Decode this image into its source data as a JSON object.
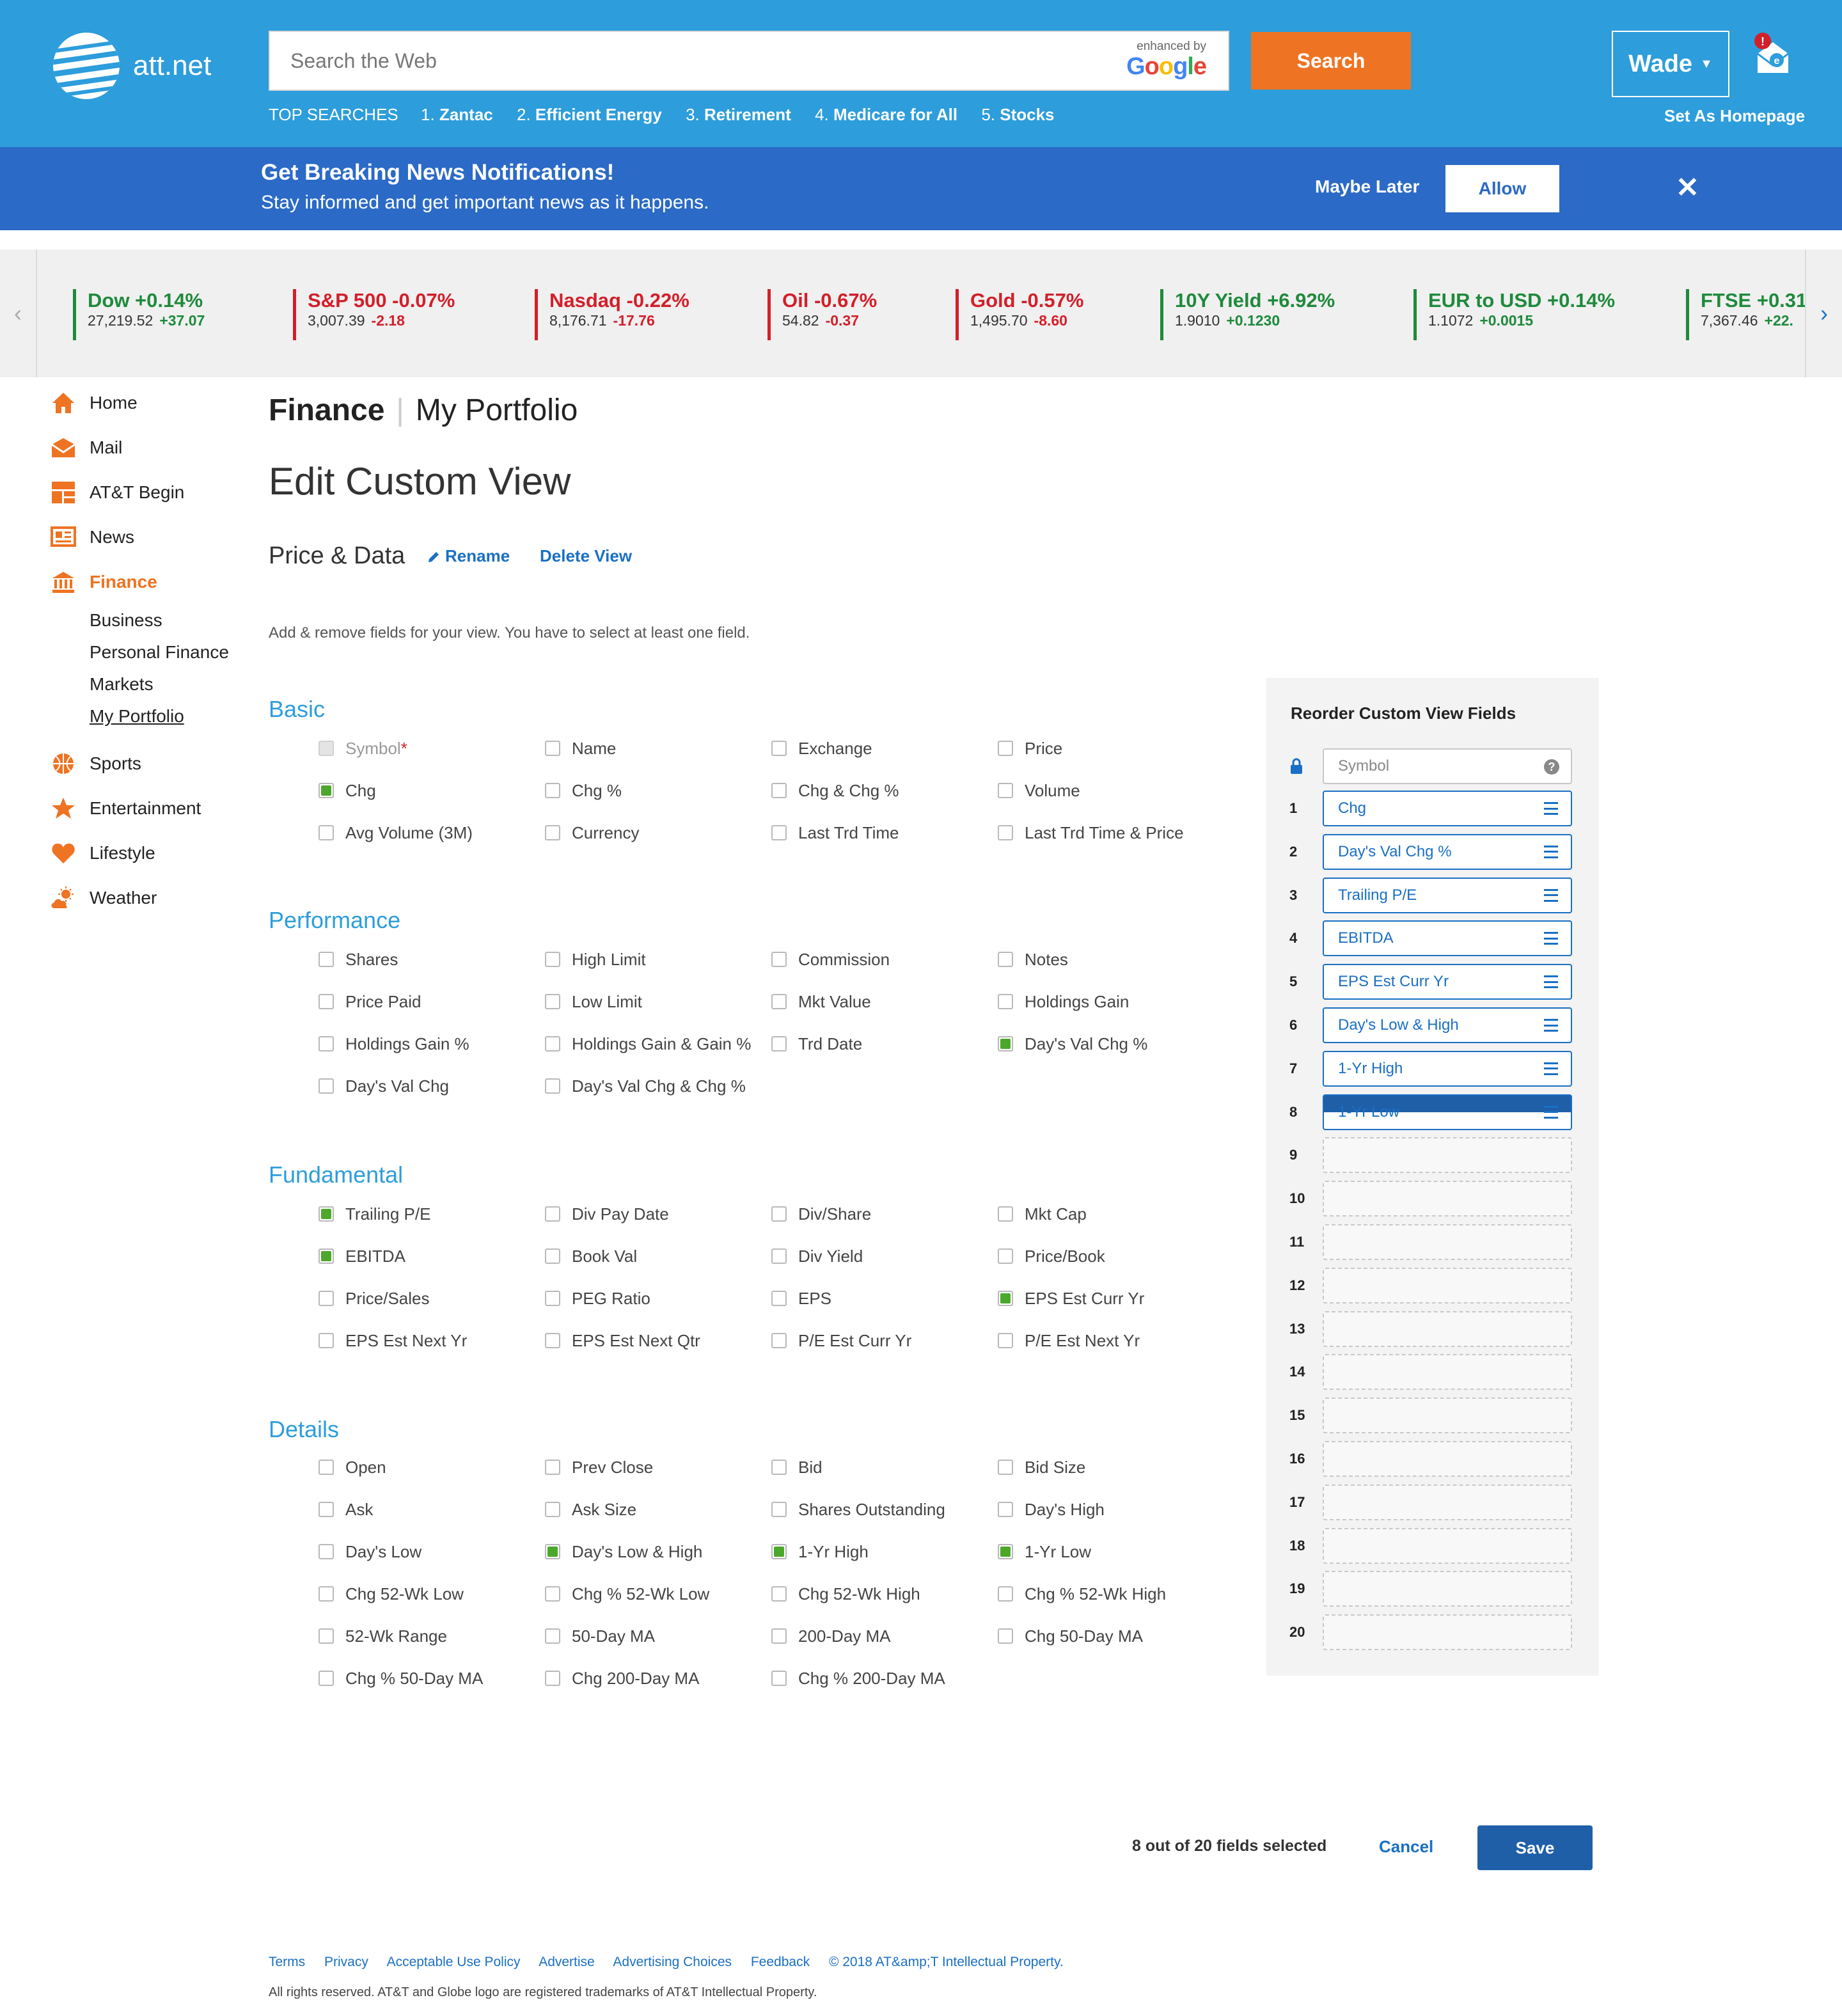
{
  "header": {
    "logo_text": "att.net",
    "search_placeholder": "Search the Web",
    "enhanced_by": "enhanced by",
    "google": "Google",
    "search_button": "Search",
    "top_searches_label": "TOP SEARCHES",
    "top_searches": [
      {
        "num": "1.",
        "term": "Zantac"
      },
      {
        "num": "2.",
        "term": "Efficient Energy"
      },
      {
        "num": "3.",
        "term": "Retirement"
      },
      {
        "num": "4.",
        "term": "Medicare for All"
      },
      {
        "num": "5.",
        "term": "Stocks"
      }
    ],
    "user_name": "Wade",
    "mail_badge": "!",
    "set_homepage": "Set As Homepage"
  },
  "notification": {
    "title": "Get Breaking News Notifications!",
    "subtitle": "Stay informed and get important news as it happens.",
    "maybe_later": "Maybe Later",
    "allow": "Allow"
  },
  "ticker": [
    {
      "name": "Dow +0.14%",
      "value": "27,219.52",
      "change": "+37.07",
      "dir": "up"
    },
    {
      "name": "S&P 500 -0.07%",
      "value": "3,007.39",
      "change": "-2.18",
      "dir": "down"
    },
    {
      "name": "Nasdaq -0.22%",
      "value": "8,176.71",
      "change": "-17.76",
      "dir": "down"
    },
    {
      "name": "Oil -0.67%",
      "value": "54.82",
      "change": "-0.37",
      "dir": "down"
    },
    {
      "name": "Gold -0.57%",
      "value": "1,495.70",
      "change": "-8.60",
      "dir": "down"
    },
    {
      "name": "10Y Yield +6.92%",
      "value": "1.9010",
      "change": "+0.1230",
      "dir": "up"
    },
    {
      "name": "EUR to USD +0.14%",
      "value": "1.1072",
      "change": "+0.0015",
      "dir": "up"
    },
    {
      "name": "FTSE +0.31",
      "value": "7,367.46",
      "change": "+22.",
      "dir": "up"
    }
  ],
  "nav": {
    "items": [
      {
        "label": "Home",
        "icon": "home-icon"
      },
      {
        "label": "Mail",
        "icon": "mail-icon"
      },
      {
        "label": "AT&T Begin",
        "icon": "begin-icon"
      },
      {
        "label": "News",
        "icon": "news-icon"
      },
      {
        "label": "Finance",
        "icon": "finance-icon"
      },
      {
        "label": "Sports",
        "icon": "sports-icon"
      },
      {
        "label": "Entertainment",
        "icon": "star-icon"
      },
      {
        "label": "Lifestyle",
        "icon": "heart-icon"
      },
      {
        "label": "Weather",
        "icon": "weather-icon"
      }
    ],
    "finance_sub": [
      "Business",
      "Personal Finance",
      "Markets",
      "My Portfolio"
    ]
  },
  "main": {
    "breadcrumb_section": "Finance",
    "breadcrumb_page": "My Portfolio",
    "title": "Edit Custom View",
    "view_name": "Price & Data",
    "rename": "Rename",
    "delete_view": "Delete View",
    "instructions": "Add & remove fields for your view. You have to select at least one field.",
    "sections": [
      {
        "title": "Basic",
        "fields": [
          {
            "label": "Symbol",
            "checked": true,
            "disabled": true,
            "required": "*"
          },
          {
            "label": "Name",
            "checked": false
          },
          {
            "label": "Exchange",
            "checked": false
          },
          {
            "label": "Price",
            "checked": false
          },
          {
            "label": "Chg",
            "checked": true
          },
          {
            "label": "Chg %",
            "checked": false
          },
          {
            "label": "Chg & Chg %",
            "checked": false
          },
          {
            "label": "Volume",
            "checked": false
          },
          {
            "label": "Avg Volume (3M)",
            "checked": false
          },
          {
            "label": "Currency",
            "checked": false
          },
          {
            "label": "Last Trd Time",
            "checked": false
          },
          {
            "label": "Last Trd Time & Price",
            "checked": false
          }
        ]
      },
      {
        "title": "Performance",
        "fields": [
          {
            "label": "Shares",
            "checked": false
          },
          {
            "label": "High Limit",
            "checked": false
          },
          {
            "label": "Commission",
            "checked": false
          },
          {
            "label": "Notes",
            "checked": false
          },
          {
            "label": "Price Paid",
            "checked": false
          },
          {
            "label": "Low Limit",
            "checked": false
          },
          {
            "label": "Mkt Value",
            "checked": false
          },
          {
            "label": "Holdings Gain",
            "checked": false
          },
          {
            "label": "Holdings Gain %",
            "checked": false
          },
          {
            "label": "Holdings Gain & Gain %",
            "checked": false
          },
          {
            "label": "Trd Date",
            "checked": false
          },
          {
            "label": "Day's Val Chg %",
            "checked": true
          },
          {
            "label": "Day's Val Chg",
            "checked": false
          },
          {
            "label": "Day's Val Chg & Chg %",
            "checked": false
          }
        ]
      },
      {
        "title": "Fundamental",
        "fields": [
          {
            "label": "Trailing P/E",
            "checked": true
          },
          {
            "label": "Div Pay Date",
            "checked": false
          },
          {
            "label": "Div/Share",
            "checked": false
          },
          {
            "label": "Mkt Cap",
            "checked": false
          },
          {
            "label": "EBITDA",
            "checked": true
          },
          {
            "label": "Book Val",
            "checked": false
          },
          {
            "label": "Div Yield",
            "checked": false
          },
          {
            "label": "Price/Book",
            "checked": false
          },
          {
            "label": "Price/Sales",
            "checked": false
          },
          {
            "label": "PEG Ratio",
            "checked": false
          },
          {
            "label": "EPS",
            "checked": false
          },
          {
            "label": "EPS Est Curr Yr",
            "checked": true
          },
          {
            "label": "EPS Est Next Yr",
            "checked": false
          },
          {
            "label": "EPS Est Next Qtr",
            "checked": false
          },
          {
            "label": "P/E Est Curr Yr",
            "checked": false
          },
          {
            "label": "P/E Est Next Yr",
            "checked": false
          }
        ]
      },
      {
        "title": "Details",
        "fields": [
          {
            "label": "Open",
            "checked": false
          },
          {
            "label": "Prev Close",
            "checked": false
          },
          {
            "label": "Bid",
            "checked": false
          },
          {
            "label": "Bid Size",
            "checked": false
          },
          {
            "label": "Ask",
            "checked": false
          },
          {
            "label": "Ask Size",
            "checked": false
          },
          {
            "label": "Shares Outstanding",
            "checked": false
          },
          {
            "label": "Day's High",
            "checked": false
          },
          {
            "label": "Day's Low",
            "checked": false
          },
          {
            "label": "Day's Low & High",
            "checked": true
          },
          {
            "label": "1-Yr High",
            "checked": true
          },
          {
            "label": "1-Yr Low",
            "checked": true
          },
          {
            "label": "Chg 52-Wk Low",
            "checked": false
          },
          {
            "label": "Chg % 52-Wk Low",
            "checked": false
          },
          {
            "label": "Chg 52-Wk High",
            "checked": false
          },
          {
            "label": "Chg % 52-Wk High",
            "checked": false
          },
          {
            "label": "52-Wk Range",
            "checked": false
          },
          {
            "label": "50-Day MA",
            "checked": false
          },
          {
            "label": "200-Day MA",
            "checked": false
          },
          {
            "label": "Chg 50-Day MA",
            "checked": false
          },
          {
            "label": "Chg % 50-Day MA",
            "checked": false
          },
          {
            "label": "Chg 200-Day MA",
            "checked": false
          },
          {
            "label": "Chg % 200-Day MA",
            "checked": false
          }
        ]
      }
    ]
  },
  "reorder": {
    "title": "Reorder Custom View Fields",
    "locked_field": "Symbol",
    "help": "?",
    "slots": [
      {
        "num": "1",
        "label": "Chg"
      },
      {
        "num": "2",
        "label": "Day's Val Chg %"
      },
      {
        "num": "3",
        "label": "Trailing P/E"
      },
      {
        "num": "4",
        "label": "EBITDA"
      },
      {
        "num": "5",
        "label": "EPS Est Curr Yr"
      },
      {
        "num": "6",
        "label": "Day's Low & High"
      },
      {
        "num": "7",
        "label": "1-Yr High"
      },
      {
        "num": "8",
        "label": "1-Yr Low",
        "dragging": true
      },
      {
        "num": "9",
        "label": ""
      },
      {
        "num": "10",
        "label": ""
      },
      {
        "num": "11",
        "label": ""
      },
      {
        "num": "12",
        "label": ""
      },
      {
        "num": "13",
        "label": ""
      },
      {
        "num": "14",
        "label": ""
      },
      {
        "num": "15",
        "label": ""
      },
      {
        "num": "16",
        "label": ""
      },
      {
        "num": "17",
        "label": ""
      },
      {
        "num": "18",
        "label": ""
      },
      {
        "num": "19",
        "label": ""
      },
      {
        "num": "20",
        "label": ""
      }
    ]
  },
  "actions": {
    "fields_count": "8 out of 20 fields selected",
    "cancel": "Cancel",
    "save": "Save"
  },
  "footer": {
    "links": [
      "Terms",
      "Privacy",
      "Acceptable Use Policy",
      "Advertise",
      "Advertising Choices",
      "Feedback",
      "© 2018 AT&amp;T Intellectual Property."
    ],
    "copyright": "All rights reserved. AT&T and Globe logo are registered trademarks of AT&T Intellectual Property."
  },
  "colors": {
    "header_blue": "#2d9ddb",
    "notif_blue": "#2b6ac6",
    "accent_orange": "#ee7322",
    "link_blue": "#1a6fc4",
    "up_green": "#1e8a3c",
    "down_red": "#d21f2a",
    "check_green": "#4ca82a"
  }
}
